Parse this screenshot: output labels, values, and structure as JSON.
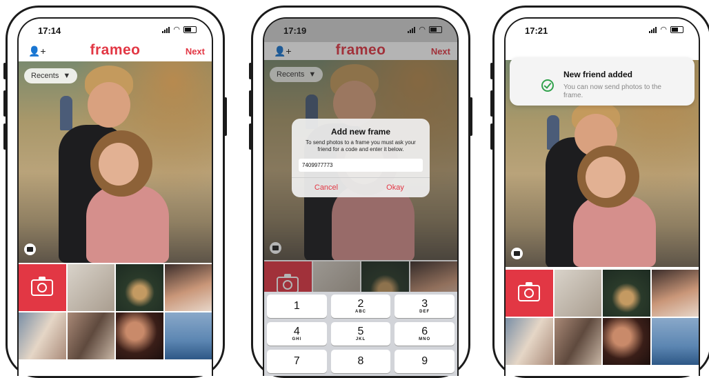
{
  "brand": {
    "logo_text": "frameo",
    "accent": "#e23744"
  },
  "screens": [
    {
      "time": "17:14",
      "header": {
        "next_label": "Next"
      },
      "recents_label": "Recents"
    },
    {
      "time": "17:19",
      "header": {
        "next_label": "Next"
      },
      "recents_label": "Recents",
      "dialog": {
        "title": "Add new frame",
        "message": "To send photos to a frame you must ask your friend for a code and enter it below.",
        "code_value": "7409977773",
        "cancel_label": "Cancel",
        "okay_label": "Okay"
      },
      "keypad": [
        {
          "digit": "1",
          "letters": ""
        },
        {
          "digit": "2",
          "letters": "ABC"
        },
        {
          "digit": "3",
          "letters": "DEF"
        },
        {
          "digit": "4",
          "letters": "GHI"
        },
        {
          "digit": "5",
          "letters": "JKL"
        },
        {
          "digit": "6",
          "letters": "MNO"
        },
        {
          "digit": "7",
          "letters": ""
        },
        {
          "digit": "8",
          "letters": ""
        },
        {
          "digit": "9",
          "letters": ""
        }
      ]
    },
    {
      "time": "17:21",
      "toast": {
        "title": "New friend added",
        "message": "You can now send photos to the frame."
      }
    }
  ],
  "icons": {
    "add_friend": "person-plus-icon",
    "camera": "camera-icon",
    "gallery": "gallery-icon",
    "success": "check-circle-icon",
    "dropdown": "caret-down-icon"
  }
}
